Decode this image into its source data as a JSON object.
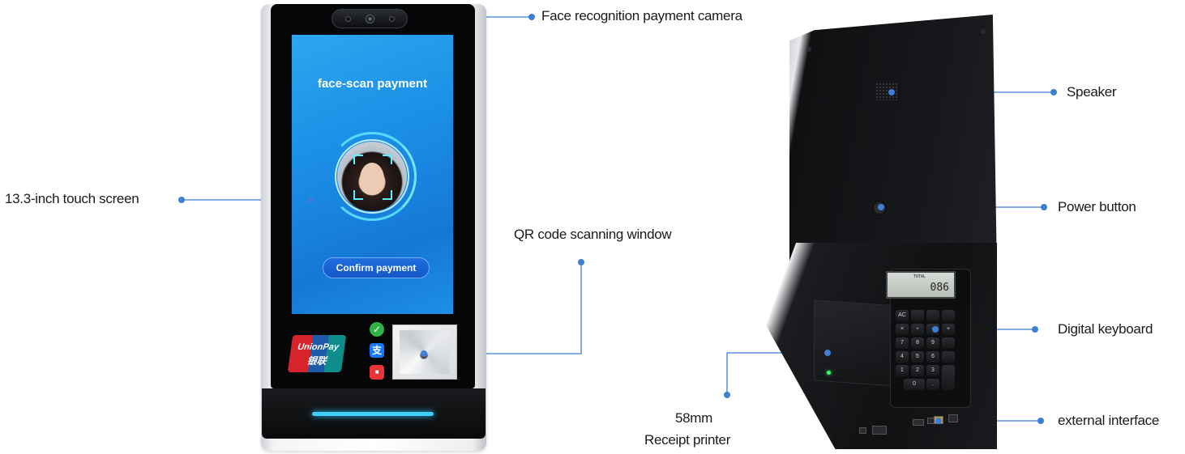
{
  "labels": {
    "camera": "Face recognition payment camera",
    "touch_screen": "13.3-inch touch screen",
    "qr_window": "QR code scanning window",
    "speaker": "Speaker",
    "power_button": "Power button",
    "digital_keyboard": "Digital keyboard",
    "printer_line1": "58mm",
    "printer_line2": "Receipt printer",
    "external_interface": "external interface"
  },
  "screen": {
    "title": "face-scan payment",
    "confirm_button": "Confirm payment"
  },
  "payment_logos": {
    "unionpay_line1": "UnionPay",
    "unionpay_line2": "银联"
  },
  "keypad_display": {
    "label": "TOTAL",
    "value": "086"
  },
  "colors": {
    "callout_line": "#3c7fd4",
    "screen_blue": "#1b8ee6",
    "accent_light": "#3fd0ff"
  }
}
